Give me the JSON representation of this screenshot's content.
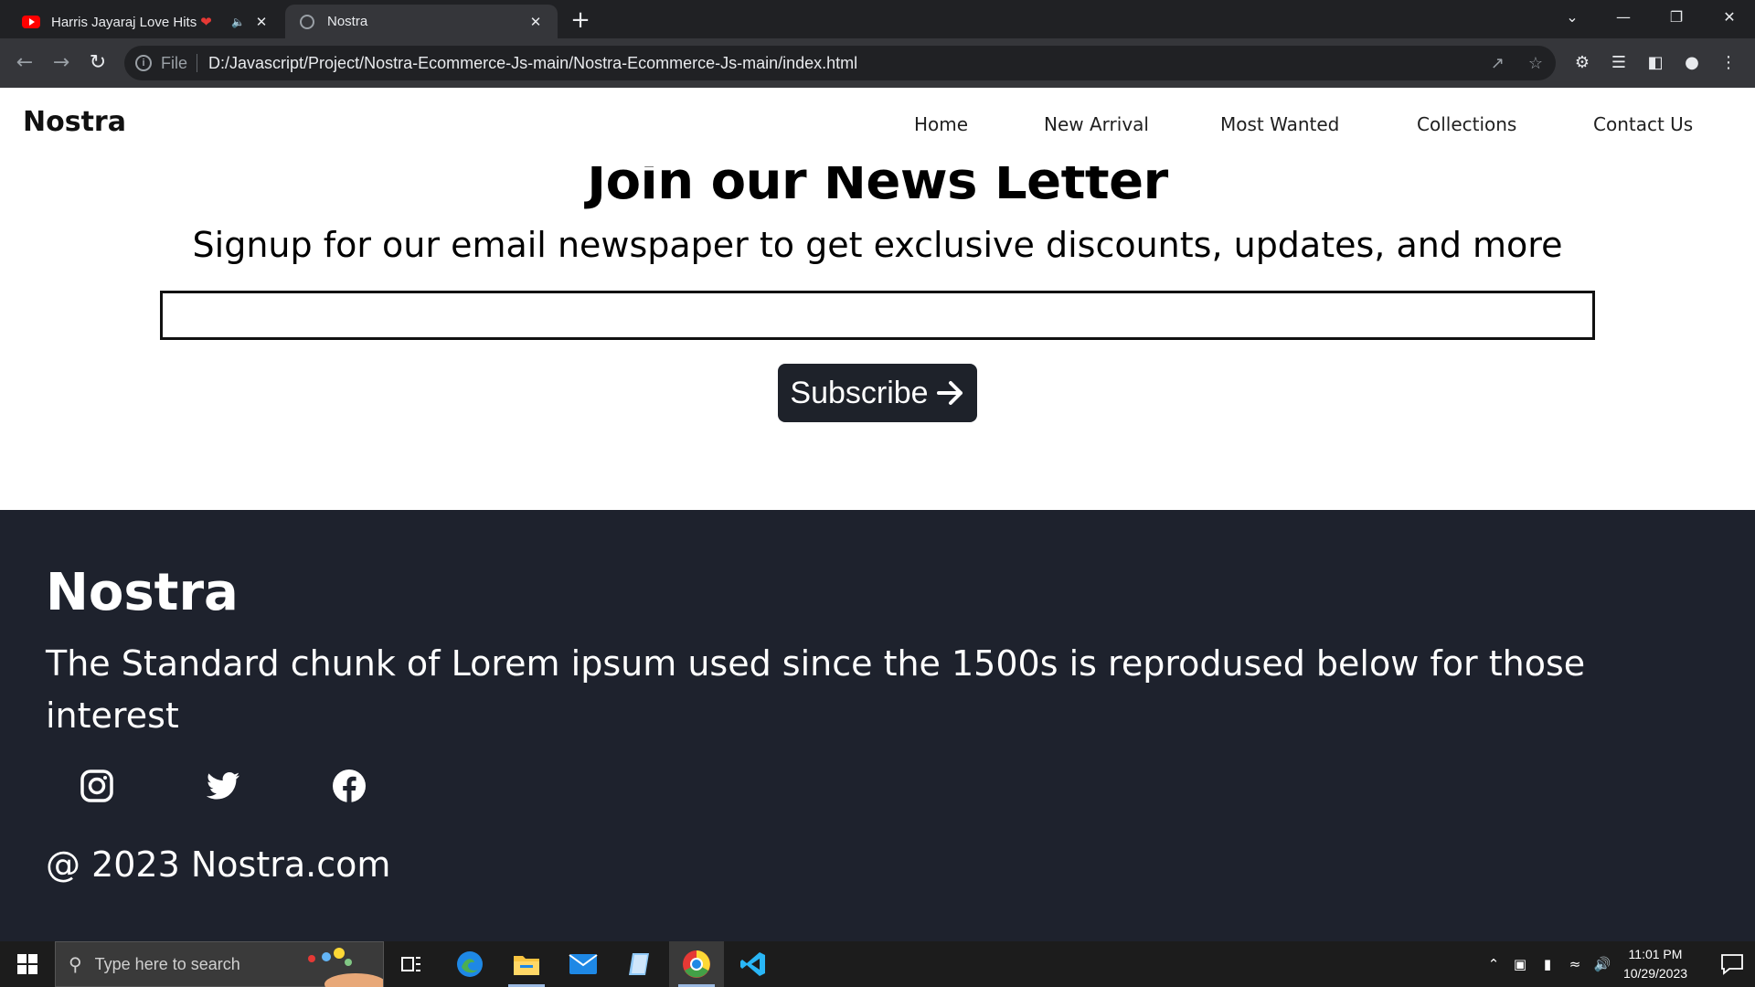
{
  "browser": {
    "tabs": [
      {
        "title": "Harris Jayaraj Love Hits",
        "favicon": "youtube-icon",
        "audio": "muted-speaker-icon"
      },
      {
        "title": "Nostra",
        "favicon": "globe-icon",
        "active": true
      }
    ],
    "address": {
      "scheme": "File",
      "url": "D:/Javascript/Project/Nostra-Ecommerce-Js-main/Nostra-Ecommerce-Js-main/index.html"
    }
  },
  "site": {
    "logo": "Nostra",
    "nav": [
      "Home",
      "New Arrival",
      "Most Wanted",
      "Collections",
      "Contact Us"
    ]
  },
  "newsletter": {
    "title": "Join our News Letter",
    "subtitle": "Signup for our email newspaper to get exclusive discounts, updates, and more",
    "input_value": "",
    "button_label": "Subscribe"
  },
  "footer": {
    "logo": "Nostra",
    "text": "The Standard chunk of Lorem ipsum used since the 1500s is reprodused below for those interest",
    "social": [
      "instagram-icon",
      "twitter-icon",
      "facebook-icon"
    ],
    "copyright": "@ 2023 Nostra.com"
  },
  "taskbar": {
    "search_placeholder": "Type here to search",
    "time": "11:01 PM",
    "date": "10/29/2023"
  },
  "colors": {
    "footer_bg": "#1e222d",
    "button_bg": "#1e222a",
    "chrome_dark": "#202124",
    "chrome_toolbar": "#35363a"
  }
}
